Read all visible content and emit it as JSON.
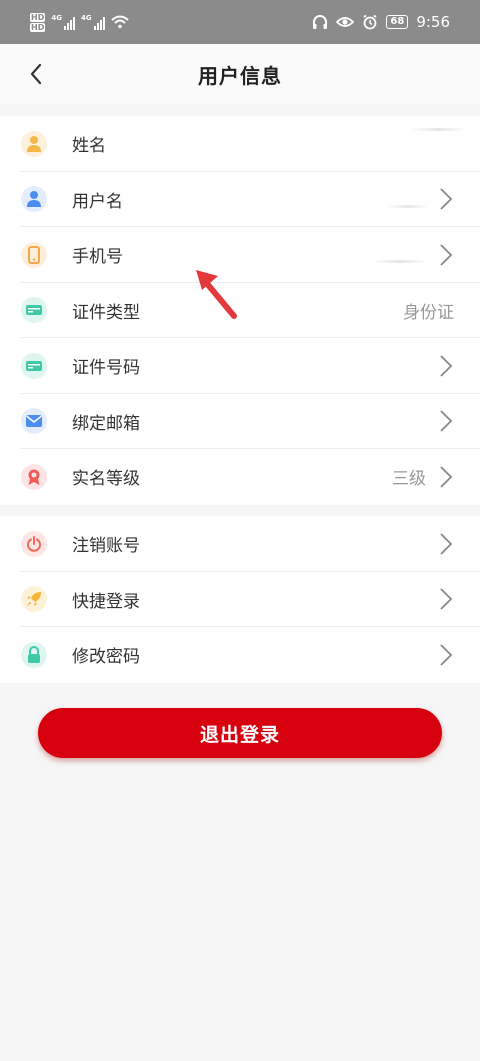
{
  "status_bar": {
    "hd_labels": [
      "HD",
      "HD"
    ],
    "network_labels": [
      "4G",
      "4G"
    ],
    "battery": "68",
    "time": "9:56"
  },
  "header": {
    "title": "用户信息",
    "back_icon": "chevron-left-icon"
  },
  "profile_items": [
    {
      "label": "姓名",
      "value": "",
      "icon": "person-icon",
      "color": "#f6b74a"
    },
    {
      "label": "用户名",
      "value": "",
      "icon": "user-icon",
      "color": "#4c8ef0"
    },
    {
      "label": "手机号",
      "value": "",
      "icon": "phone-icon",
      "color": "#f6a94a"
    },
    {
      "label": "证件类型",
      "value": "身份证",
      "icon": "id-card-icon",
      "color": "#3ec9a7"
    },
    {
      "label": "证件号码",
      "value": "",
      "icon": "id-card-icon",
      "color": "#3ec9a7"
    },
    {
      "label": "绑定邮箱",
      "value": "",
      "icon": "mail-icon",
      "color": "#4c8ef0"
    },
    {
      "label": "实名等级",
      "value": "三级",
      "icon": "badge-icon",
      "color": "#ef5a5a"
    }
  ],
  "account_items": [
    {
      "label": "注销账号",
      "icon": "power-icon",
      "color": "#f26a5a"
    },
    {
      "label": "快捷登录",
      "icon": "rocket-icon",
      "color": "#f6b535"
    },
    {
      "label": "修改密码",
      "icon": "lock-icon",
      "color": "#3ec9a7"
    }
  ],
  "logout_button": "退出登录",
  "accent_color": "#d7000f"
}
